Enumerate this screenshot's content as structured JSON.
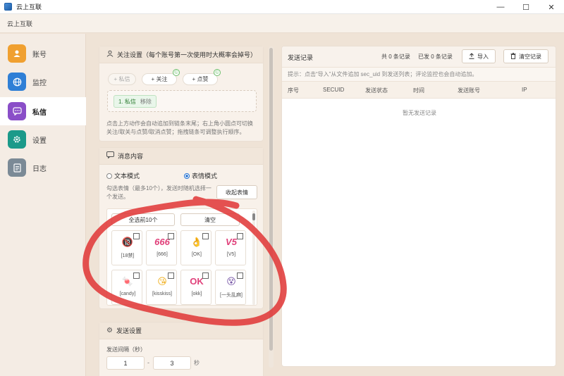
{
  "window": {
    "title": "云上互联",
    "minimize": "—",
    "maximize": "☐",
    "close": "✕"
  },
  "menubar": {
    "brand": "云上互联"
  },
  "sidebar": {
    "items": [
      {
        "label": "账号",
        "icon": "user-icon",
        "glyph": "👤",
        "color": "#f0a030"
      },
      {
        "label": "监控",
        "icon": "globe-icon",
        "glyph": "🌐",
        "color": "#2f7fd6"
      },
      {
        "label": "私信",
        "icon": "chat-icon",
        "glyph": "💬",
        "color": "#8a4ec8"
      },
      {
        "label": "设置",
        "icon": "gear-icon",
        "glyph": "⚙",
        "color": "#1b9a8a"
      },
      {
        "label": "日志",
        "icon": "log-icon",
        "glyph": "📄",
        "color": "#7b8a96"
      }
    ],
    "active_index": 2
  },
  "follow_settings": {
    "title": "关注设置（每个账号第一次使用时大概率会掉号）",
    "buttons": [
      "+ 私信",
      "+ 关注",
      "+ 点赞"
    ],
    "badge": "©",
    "chip_label": "1. 私信",
    "chip_remove": "移除",
    "hint": "点击上方动作会自动追加到链条末尾；右上角小圆点可切换关注/取关与点赞/取消点赞；拖拽链条可调整执行顺序。"
  },
  "message_content": {
    "title": "消息内容",
    "mode_text": "文本模式",
    "mode_emoji": "表情模式",
    "selected_mode": "表情模式",
    "hint": "勾选表情（最多10个），发送时随机选择一个发送。",
    "collapse_button": "收起表情",
    "select_first10": "全选前10个",
    "clear": "清空",
    "emojis": [
      {
        "label": "[18禁]",
        "glyph": "🔞",
        "color": "#d23c8c"
      },
      {
        "label": "[666]",
        "glyph": "666",
        "color": "#e0407a"
      },
      {
        "label": "[OK]",
        "glyph": "👌",
        "color": "#f0b020"
      },
      {
        "label": "[V5]",
        "glyph": "V5",
        "color": "#e0407a"
      },
      {
        "label": "[candy]",
        "glyph": "🍬",
        "color": "#d2464a"
      },
      {
        "label": "[kisskiss]",
        "glyph": "😘",
        "color": "#f0b020"
      },
      {
        "label": "[okk]",
        "glyph": "OK",
        "color": "#e0407a"
      },
      {
        "label": "[一头乱麻]",
        "glyph": "😵",
        "color": "#7a5aa8"
      }
    ]
  },
  "send_settings": {
    "title": "发送设置",
    "interval_label": "发送间隔（秒）",
    "min": "1",
    "sep": "-",
    "max": "3",
    "unit": "秒"
  },
  "records": {
    "title": "发送记录",
    "total_label": "共 0 条记录",
    "sent_label": "已发 0 条记录",
    "import_button": "导入",
    "clear_button": "清空记录",
    "hint": "提示：点击“导入”从文件追加 sec_uid 到发送列表；评论监控也会自动追加。",
    "columns": [
      "序号",
      "SECUID",
      "发送状态",
      "时间",
      "发送账号",
      "IP"
    ],
    "empty": "暂无发送记录"
  },
  "colors": {
    "annotation": "#e03a3a",
    "accent_blue": "#1f6fd1",
    "accent_green": "#2e7d32"
  }
}
